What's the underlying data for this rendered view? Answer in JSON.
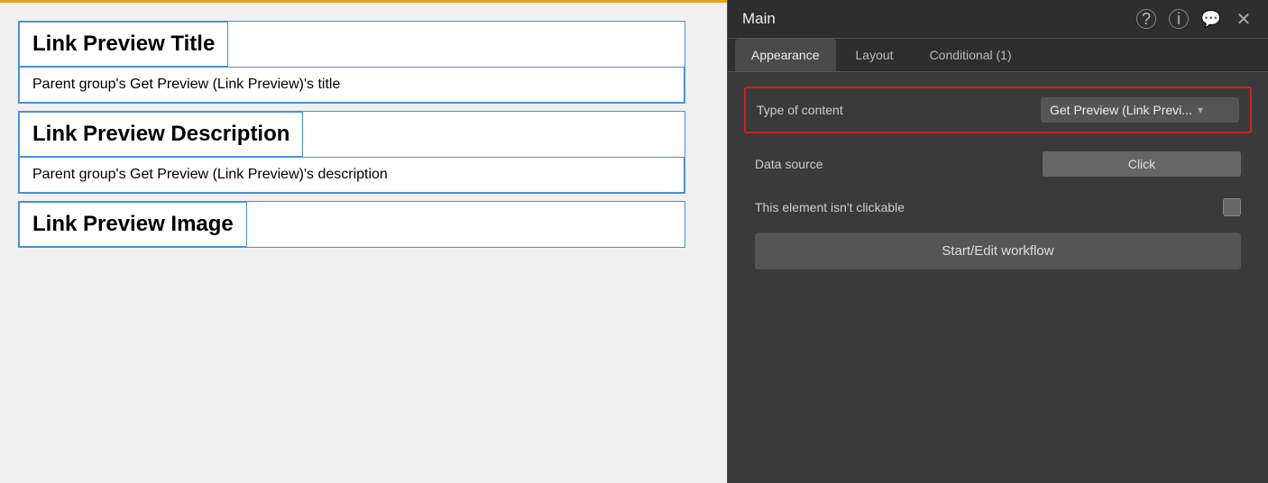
{
  "canvas": {
    "sections": [
      {
        "id": "link-preview-title",
        "title": "Link Preview Title",
        "value": "Parent group's Get Preview (Link Preview)'s title"
      },
      {
        "id": "link-preview-description",
        "title": "Link Preview Description",
        "value": "Parent group's Get Preview (Link Preview)'s description"
      },
      {
        "id": "link-preview-image",
        "title": "Link Preview Image",
        "value": null
      }
    ]
  },
  "panel": {
    "title": "Main",
    "icons": {
      "help": "?",
      "info": "i",
      "comment": "💬",
      "close": "✕"
    },
    "tabs": [
      {
        "id": "appearance",
        "label": "Appearance",
        "active": true
      },
      {
        "id": "layout",
        "label": "Layout",
        "active": false
      },
      {
        "id": "conditional",
        "label": "Conditional (1)",
        "active": false
      }
    ],
    "fields": {
      "type_of_content_label": "Type of content",
      "type_of_content_value": "Get Preview (Link Previ...",
      "data_source_label": "Data source",
      "data_source_value": "Click",
      "not_clickable_label": "This element isn't clickable",
      "workflow_button": "Start/Edit workflow"
    }
  }
}
